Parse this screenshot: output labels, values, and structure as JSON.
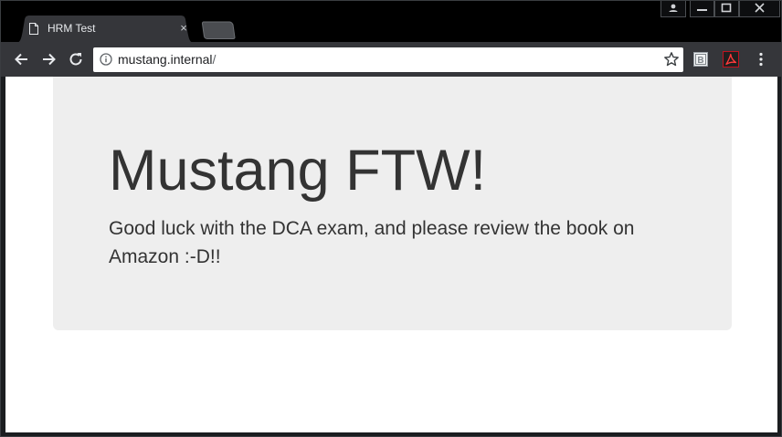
{
  "browser": {
    "tab": {
      "title": "HRM Test",
      "close_glyph": "×",
      "icon": "page-icon"
    },
    "address_bar": {
      "host": "mustang.internal",
      "path": "/",
      "icon": "info-icon"
    },
    "toolbar_icons": [
      "back-icon",
      "forward-icon",
      "reload-icon",
      "star-icon",
      "reader-extension-icon",
      "pdf-extension-icon",
      "menu-icon"
    ],
    "window_controls": [
      "profile-icon",
      "minimize-icon",
      "maximize-icon",
      "close-icon"
    ]
  },
  "page": {
    "heading": "Mustang FTW!",
    "message": "Good luck with the DCA exam, and please review the book on Amazon :-D!!",
    "colors": {
      "jumbotron_bg": "#eeeeee",
      "text": "#333333",
      "pdf_red": "#c1121f"
    }
  }
}
